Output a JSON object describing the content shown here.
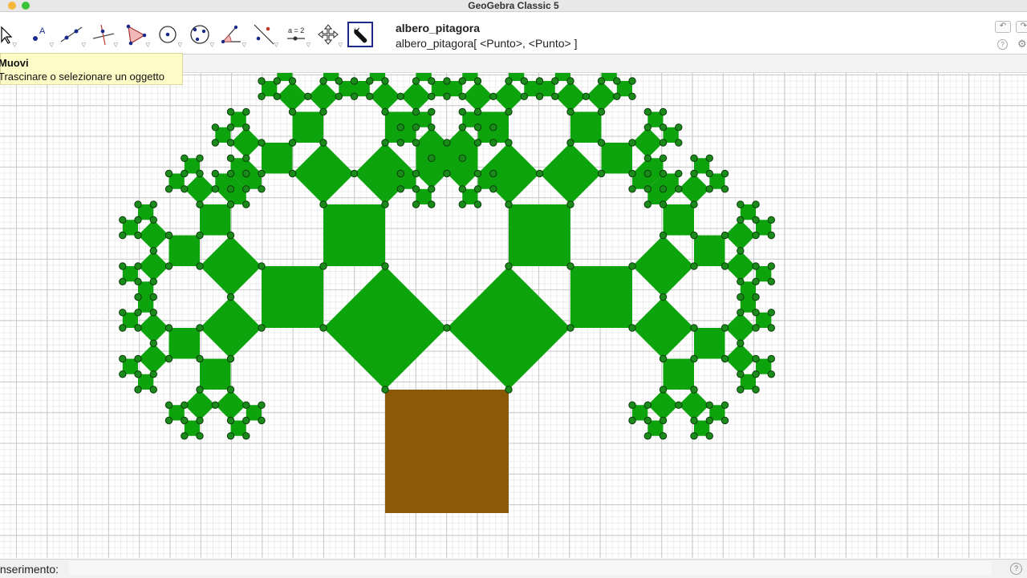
{
  "window": {
    "title": "GeoGebra Classic 5"
  },
  "toolbar": {
    "tools": [
      "move-tool",
      "point-tool",
      "line-tool",
      "perpendicular-line-tool",
      "polygon-tool",
      "circle-tool",
      "conic-tool",
      "angle-tool",
      "reflect-tool",
      "slider-tool",
      "move-graphics-view-tool",
      "custom-tool"
    ],
    "active_tool": "custom-tool"
  },
  "help": {
    "title": "albero_pitagora",
    "syntax": "albero_pitagora[ <Punto>, <Punto> ]"
  },
  "tooltip": {
    "title": "Muovi",
    "description": "Trascinare o selezionare un oggetto"
  },
  "input_bar": {
    "label": "Inserimento:",
    "value": ""
  },
  "icons": {
    "undo": "undo-icon",
    "redo": "redo-icon",
    "help": "help-icon",
    "settings": "gear-icon",
    "slider_label": "a = 2"
  },
  "colors": {
    "leaf_green": "#0ca30c",
    "point_green": "#1a8a1a",
    "trunk_brown": "#8b5a08",
    "active_tool_border": "#1d2a8a",
    "tooltip_bg": "#fffdc7"
  }
}
